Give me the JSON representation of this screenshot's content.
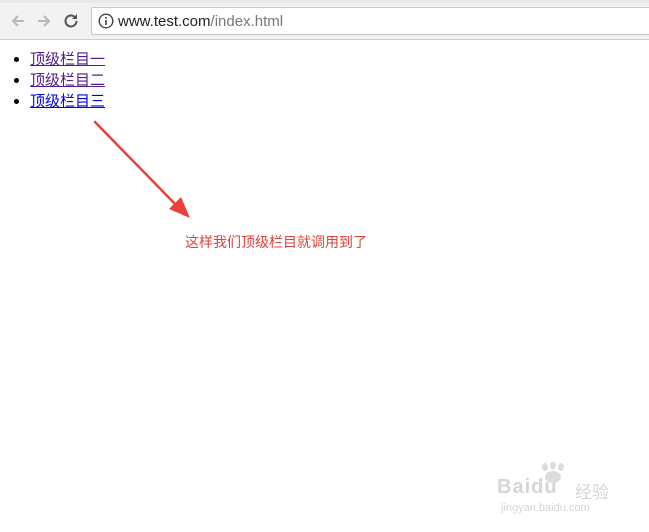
{
  "browser": {
    "url_host": "www.test.com",
    "url_path": "/index.html"
  },
  "menu": {
    "items": [
      {
        "label": "顶级栏目一",
        "state": "visited"
      },
      {
        "label": "顶级栏目二",
        "state": "visited"
      },
      {
        "label": "顶级栏目三",
        "state": "unvisited"
      }
    ]
  },
  "annotation": {
    "text": "这样我们顶级栏目就调用到了",
    "color": "#e0423c"
  },
  "watermark": {
    "logo": "Baidu",
    "label": "经验",
    "site": "jingyan.baidu.com"
  }
}
